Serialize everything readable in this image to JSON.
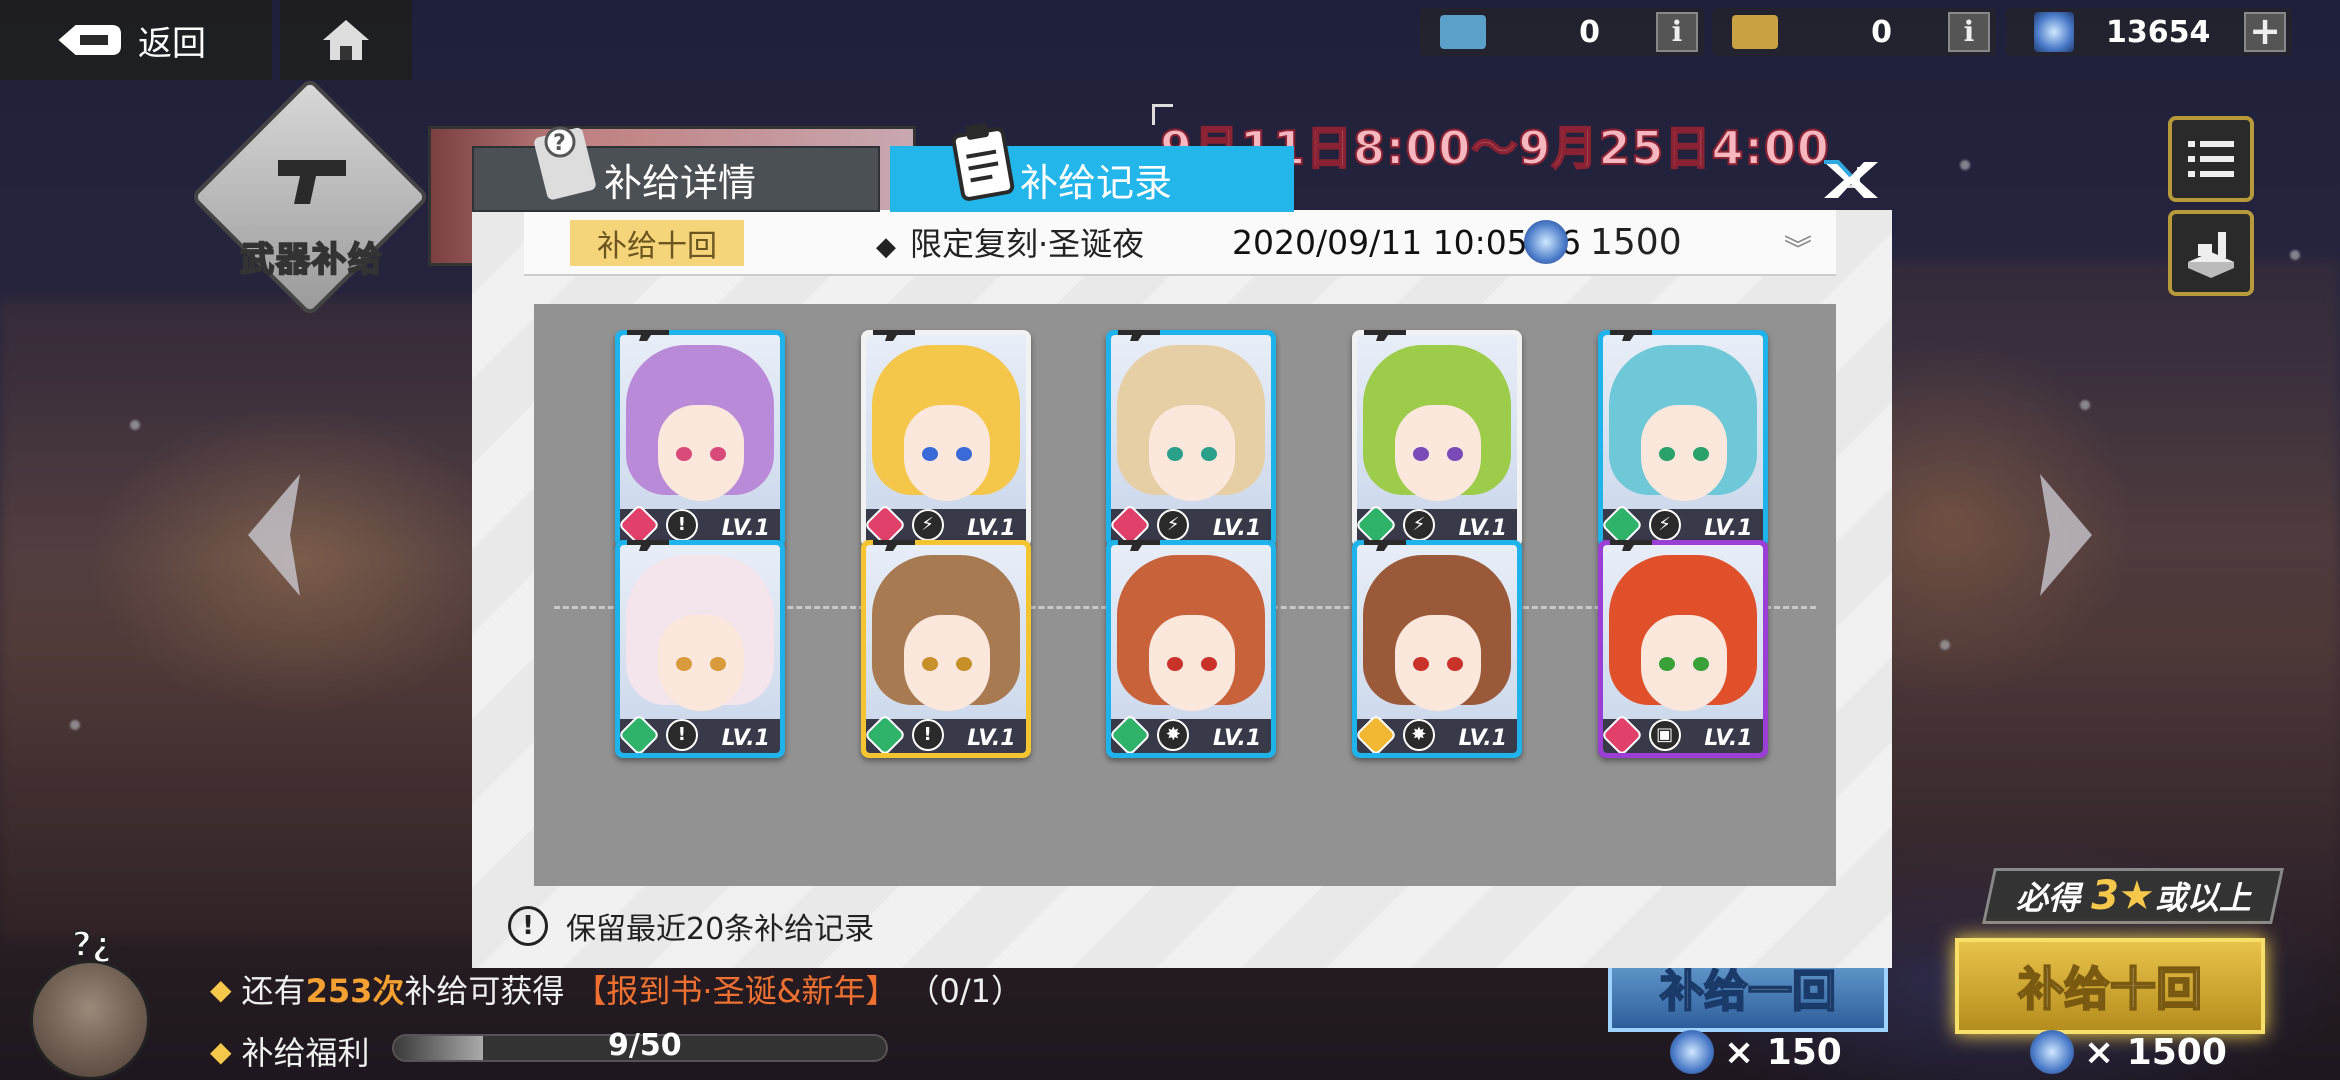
{
  "topbar": {
    "back_label": "返回",
    "resources": [
      {
        "name": "ticket-blue",
        "value": "0",
        "color": "#5aa0c8"
      },
      {
        "name": "ticket-gold",
        "value": "0",
        "color": "#c9a244"
      },
      {
        "name": "crystal",
        "value": "13654",
        "color": "#4a7ac8"
      }
    ],
    "info_label": "i",
    "plus_label": "+"
  },
  "side": {
    "weapon_label": "武器补给",
    "date_range": "9月11日8:00～9月25日4:00"
  },
  "modal": {
    "tabs": [
      {
        "label": "补给详情",
        "active": false
      },
      {
        "label": "补给记录",
        "active": true
      }
    ],
    "record": {
      "tag": "补给十回",
      "pool": "限定复刻·圣诞夜",
      "time": "2020/09/11 10:05:36",
      "cost": "1500"
    },
    "cards": [
      {
        "rarity_color": "#1fb3ec",
        "hair": "#b98ad8",
        "eyes": "#d84a7a",
        "class_color": "#e0406a",
        "type": "!",
        "level": "LV.1"
      },
      {
        "rarity_color": "#f2f2f2",
        "hair": "#f4c74a",
        "eyes": "#3a6ad8",
        "class_color": "#e0406a",
        "type": "⚡",
        "level": "LV.1"
      },
      {
        "rarity_color": "#1fb3ec",
        "hair": "#e6cfa4",
        "eyes": "#2aa08a",
        "class_color": "#e0406a",
        "type": "⚡",
        "level": "LV.1"
      },
      {
        "rarity_color": "#f2f2f2",
        "hair": "#9ccc4a",
        "eyes": "#7a4ab8",
        "class_color": "#2fb36a",
        "type": "⚡",
        "level": "LV.1"
      },
      {
        "rarity_color": "#1fb3ec",
        "hair": "#6ec8d8",
        "eyes": "#2aa06a",
        "class_color": "#2fb36a",
        "type": "⚡",
        "level": "LV.1"
      },
      {
        "rarity_color": "#1fb3ec",
        "hair": "#f4e4ec",
        "eyes": "#d89a3a",
        "class_color": "#2fb36a",
        "type": "!",
        "level": "LV.1"
      },
      {
        "rarity_color": "#f5c531",
        "hair": "#a87a52",
        "eyes": "#c8902a",
        "class_color": "#2fb36a",
        "type": "!",
        "level": "LV.1"
      },
      {
        "rarity_color": "#1fb3ec",
        "hair": "#c8623a",
        "eyes": "#c8322a",
        "class_color": "#2fb36a",
        "type": "✸",
        "level": "LV.1"
      },
      {
        "rarity_color": "#1fb3ec",
        "hair": "#9a5a3a",
        "eyes": "#c8322a",
        "class_color": "#f2b733",
        "type": "✸",
        "level": "LV.1"
      },
      {
        "rarity_color": "#9b3ed6",
        "hair": "#e0502a",
        "eyes": "#3aa03a",
        "class_color": "#e0406a",
        "type": "▣",
        "level": "LV.1"
      }
    ],
    "note": "保留最近20条补给记录"
  },
  "bottom": {
    "remaining_prefix": "还有",
    "remaining_count": "253次",
    "remaining_suffix": "补给可获得",
    "reward_name": "【报到书·圣诞&新年】",
    "reward_progress": "（0/1）",
    "welfare_label": "补给福利",
    "welfare_progress": "9/50",
    "welfare_fraction": 0.18,
    "guarantee_prefix": "必得",
    "guarantee_star": "3★",
    "guarantee_suffix": "或以上",
    "pull1_label": "补给一回",
    "pull1_cost": "× 150",
    "pull10_label": "补给十回",
    "pull10_cost": "× 1500"
  },
  "icons": [
    "back-arrow-icon",
    "home-icon",
    "info-icon",
    "plus-icon",
    "gun-icon",
    "menu-icon",
    "stage-icon",
    "left-arrow-icon",
    "right-arrow-icon",
    "close-icon",
    "clipboard-icon",
    "question-icon",
    "chevron-down-icon",
    "crystal-icon"
  ]
}
